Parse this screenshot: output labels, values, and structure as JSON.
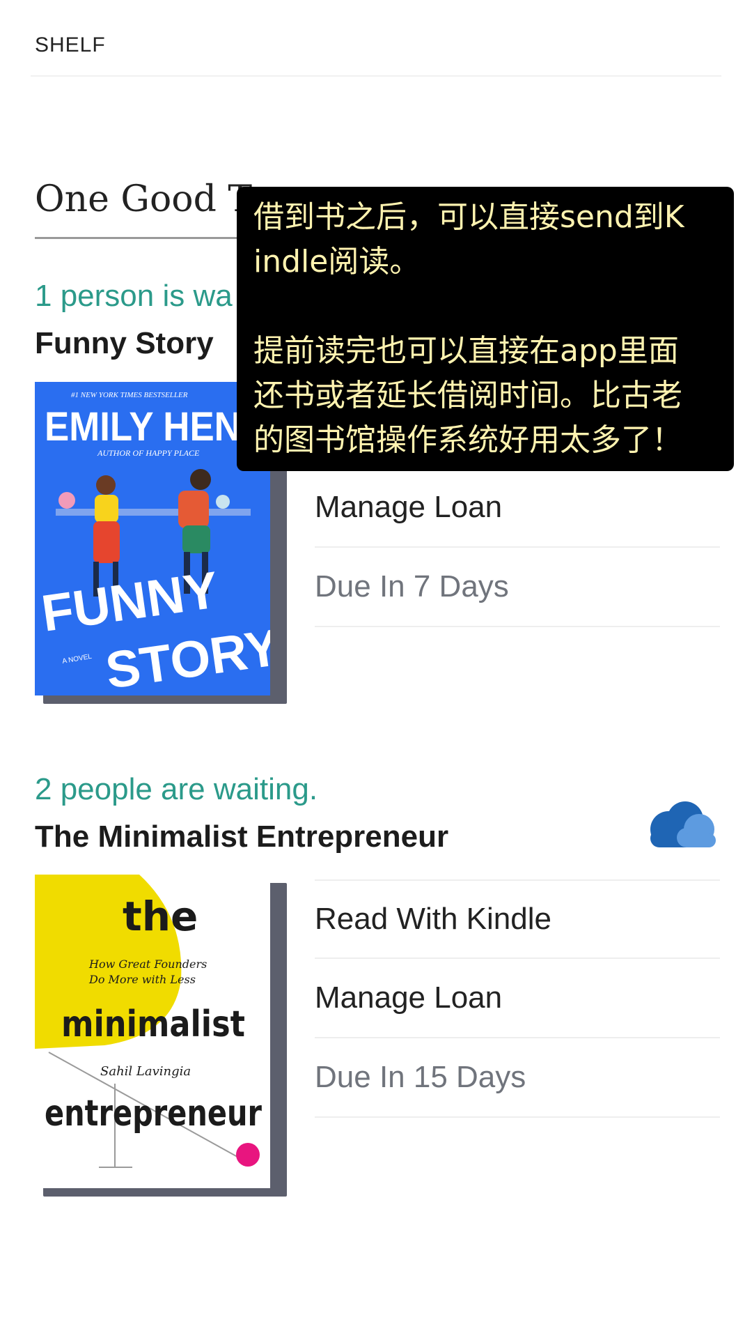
{
  "header": {
    "title": "SHELF"
  },
  "section": {
    "title": "One Good T"
  },
  "books": [
    {
      "waiting": "1 person is wa",
      "title": "Funny Story",
      "cover": {
        "top_line": "#1 NEW YORK TIMES BESTSELLER",
        "author": "EMILY HENR",
        "author_of": "AUTHOR OF HAPPY PLACE",
        "title_line1": "FUNNY",
        "title_line2": "STORY",
        "novel": "A NOVEL",
        "bg_color": "#2a6ef0"
      },
      "actions": [
        {
          "label": "Manage Loan",
          "kind": "action"
        },
        {
          "label": "Due In 7 Days",
          "kind": "status"
        }
      ]
    },
    {
      "waiting": "2 people are waiting.",
      "title": "The Minimalist Entrepreneur",
      "cover": {
        "word1": "the",
        "subtitle1": "How Great Founders",
        "subtitle2": "Do More with Less",
        "word2": "minimalist",
        "author": "Sahil Lavingia",
        "word3": "entrepreneur",
        "accent_color": "#f0dc00",
        "dot_color": "#e8157f"
      },
      "actions": [
        {
          "label": "Read With Kindle",
          "kind": "action"
        },
        {
          "label": "Manage Loan",
          "kind": "action"
        },
        {
          "label": "Due In 15 Days",
          "kind": "status"
        }
      ],
      "icon": "cloud-icon"
    }
  ],
  "overlay": {
    "line1": "借到书之后，可以直接send到K",
    "line2": "indle阅读。",
    "line3": "提前读完也可以直接在app里面",
    "line4": "还书或者延长借阅时间。比古老",
    "line5": "的图书馆操作系统好用太多了！"
  },
  "colors": {
    "waiting_text": "#2b9a8a",
    "overlay_bg": "#000000",
    "overlay_text": "#fff3b0",
    "cloud_dark": "#1f65b4",
    "cloud_light": "#5d9be0"
  }
}
